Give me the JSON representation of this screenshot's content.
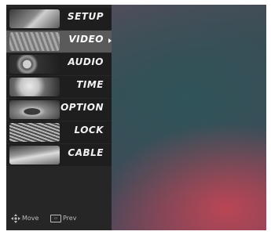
{
  "menu": {
    "items": [
      {
        "label": "SETUP",
        "icon": "setup-thumbnail",
        "selected": false
      },
      {
        "label": "VIDEO",
        "icon": "video-thumbnail",
        "selected": true
      },
      {
        "label": "AUDIO",
        "icon": "audio-thumbnail",
        "selected": false
      },
      {
        "label": "TIME",
        "icon": "time-thumbnail",
        "selected": false
      },
      {
        "label": "OPTION",
        "icon": "option-thumbnail",
        "selected": false
      },
      {
        "label": "LOCK",
        "icon": "lock-thumbnail",
        "selected": false
      },
      {
        "label": "CABLE",
        "icon": "cable-thumbnail",
        "selected": false
      }
    ]
  },
  "footer": {
    "move_label": "Move",
    "prev_label": "Prev"
  },
  "colors": {
    "panel": "#262626",
    "selected_item": "#5a5a5a",
    "label_text": "#f2f2f2",
    "background_teal": "#2d555a",
    "background_red": "#be4655"
  }
}
